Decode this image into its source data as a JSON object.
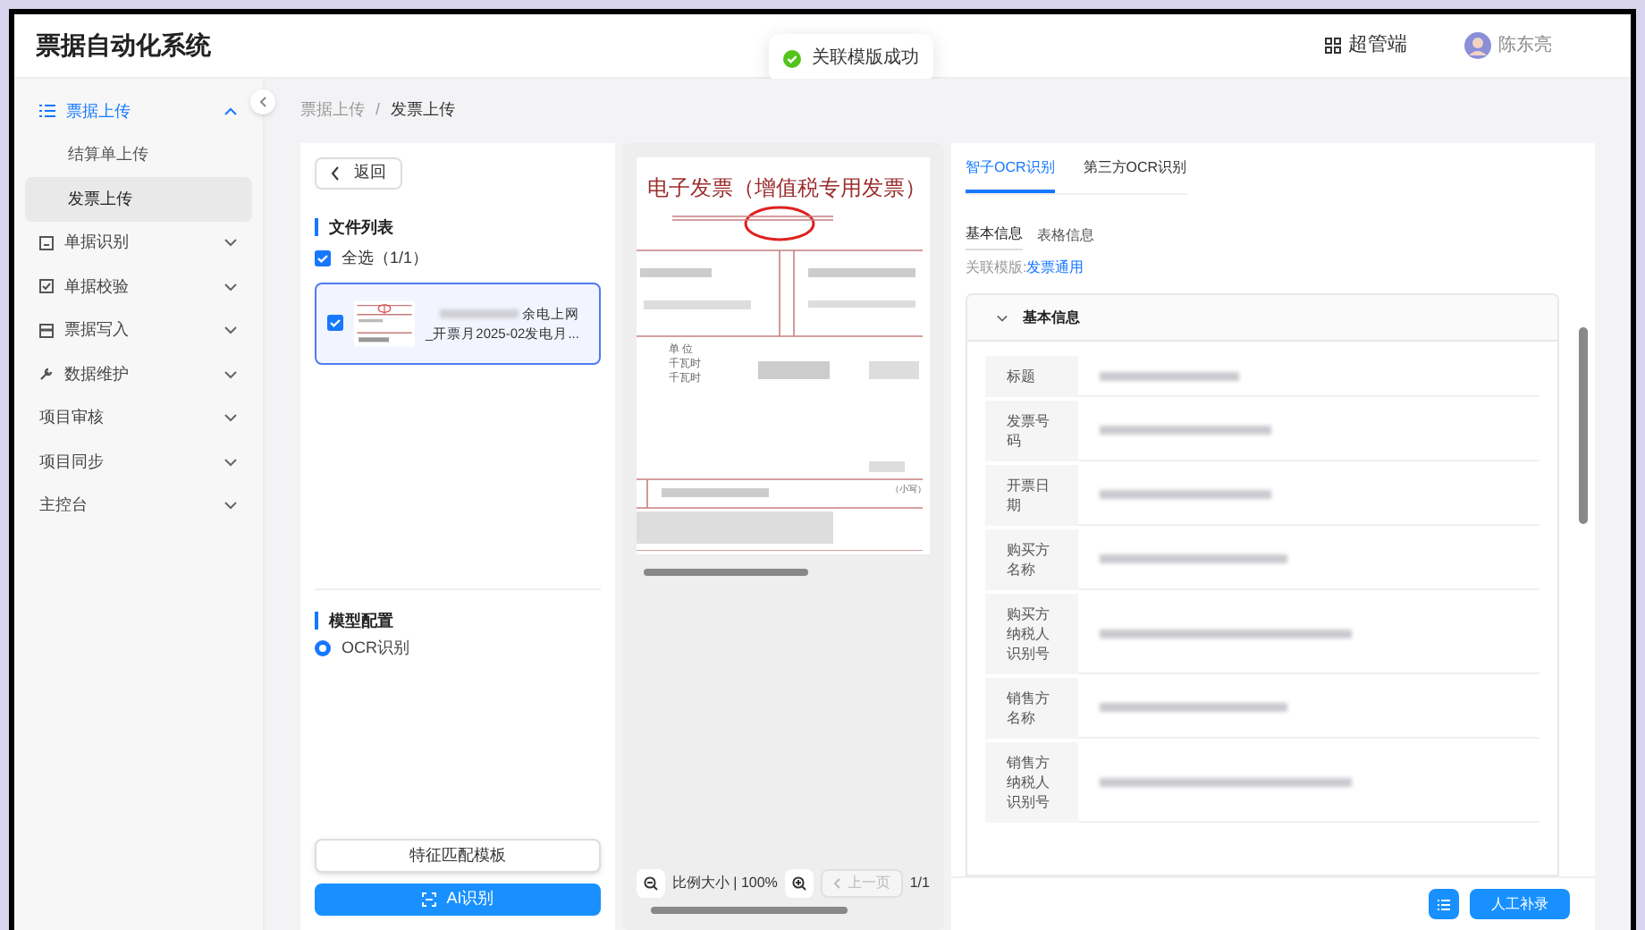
{
  "app": {
    "title": "票据自动化系统",
    "role_switch": "超管端",
    "user": "陈东亮"
  },
  "toast": {
    "text": "关联模版成功",
    "kind": "success"
  },
  "sidebar": {
    "items": [
      {
        "label": "票据上传",
        "expanded": true,
        "selected": true,
        "children": [
          {
            "label": "结算单上传",
            "selected": false
          },
          {
            "label": "发票上传",
            "selected": true
          }
        ]
      },
      {
        "label": "单据识别",
        "expanded": false,
        "selected": false
      },
      {
        "label": "单据校验",
        "expanded": false,
        "selected": false
      },
      {
        "label": "票据写入",
        "expanded": false,
        "selected": false
      },
      {
        "label": "数据维护",
        "expanded": false,
        "selected": false
      },
      {
        "label": "项目审核",
        "expanded": false,
        "selected": false
      },
      {
        "label": "项目同步",
        "expanded": false,
        "selected": false
      },
      {
        "label": "主控台",
        "expanded": false,
        "selected": false
      }
    ]
  },
  "breadcrumb": [
    "票据上传",
    "发票上传"
  ],
  "breadcrumb_separator": "/",
  "left_panel": {
    "back_button": "返回",
    "file_list_title": "文件列表",
    "select_all": {
      "label": "全选（1/1）",
      "checked": true
    },
    "files": [
      {
        "name_line_1": "余电上网",
        "name_line_2": "_开票月2025-02发电月...",
        "checked": true,
        "selected": true
      }
    ],
    "model_title": "模型配置",
    "model_options": [
      {
        "label": "OCR识别",
        "selected": true
      }
    ],
    "match_button": "特征匹配模板",
    "ai_button": "AI识别"
  },
  "preview": {
    "invoice_title": "电子发票（增值税专用发票）",
    "unit_header": "单 位",
    "units": [
      "千瓦时",
      "千瓦时"
    ],
    "lowercase_label": "（小写）",
    "zoom_label": "比例大小 | 100%",
    "prev_page": "上一页",
    "page": "1/1"
  },
  "ocr_panel": {
    "tabs": [
      {
        "label": "智子OCR识别",
        "selected": true
      },
      {
        "label": "第三方OCR识别",
        "selected": false
      }
    ],
    "subtabs": [
      {
        "label": "基本信息",
        "selected": true
      },
      {
        "label": "表格信息",
        "selected": false
      }
    ],
    "template_label": "关联模版:",
    "template_link": "发票通用",
    "section": {
      "title": "基本信息",
      "expanded": true
    },
    "fields": [
      {
        "label": "标题"
      },
      {
        "label": "发票号码"
      },
      {
        "label": "开票日期"
      },
      {
        "label": "购买方名称"
      },
      {
        "label": "购买方纳税人识别号"
      },
      {
        "label": "销售方名称"
      },
      {
        "label": "销售方纳税人识别号"
      }
    ],
    "manual_button": "人工补录"
  }
}
